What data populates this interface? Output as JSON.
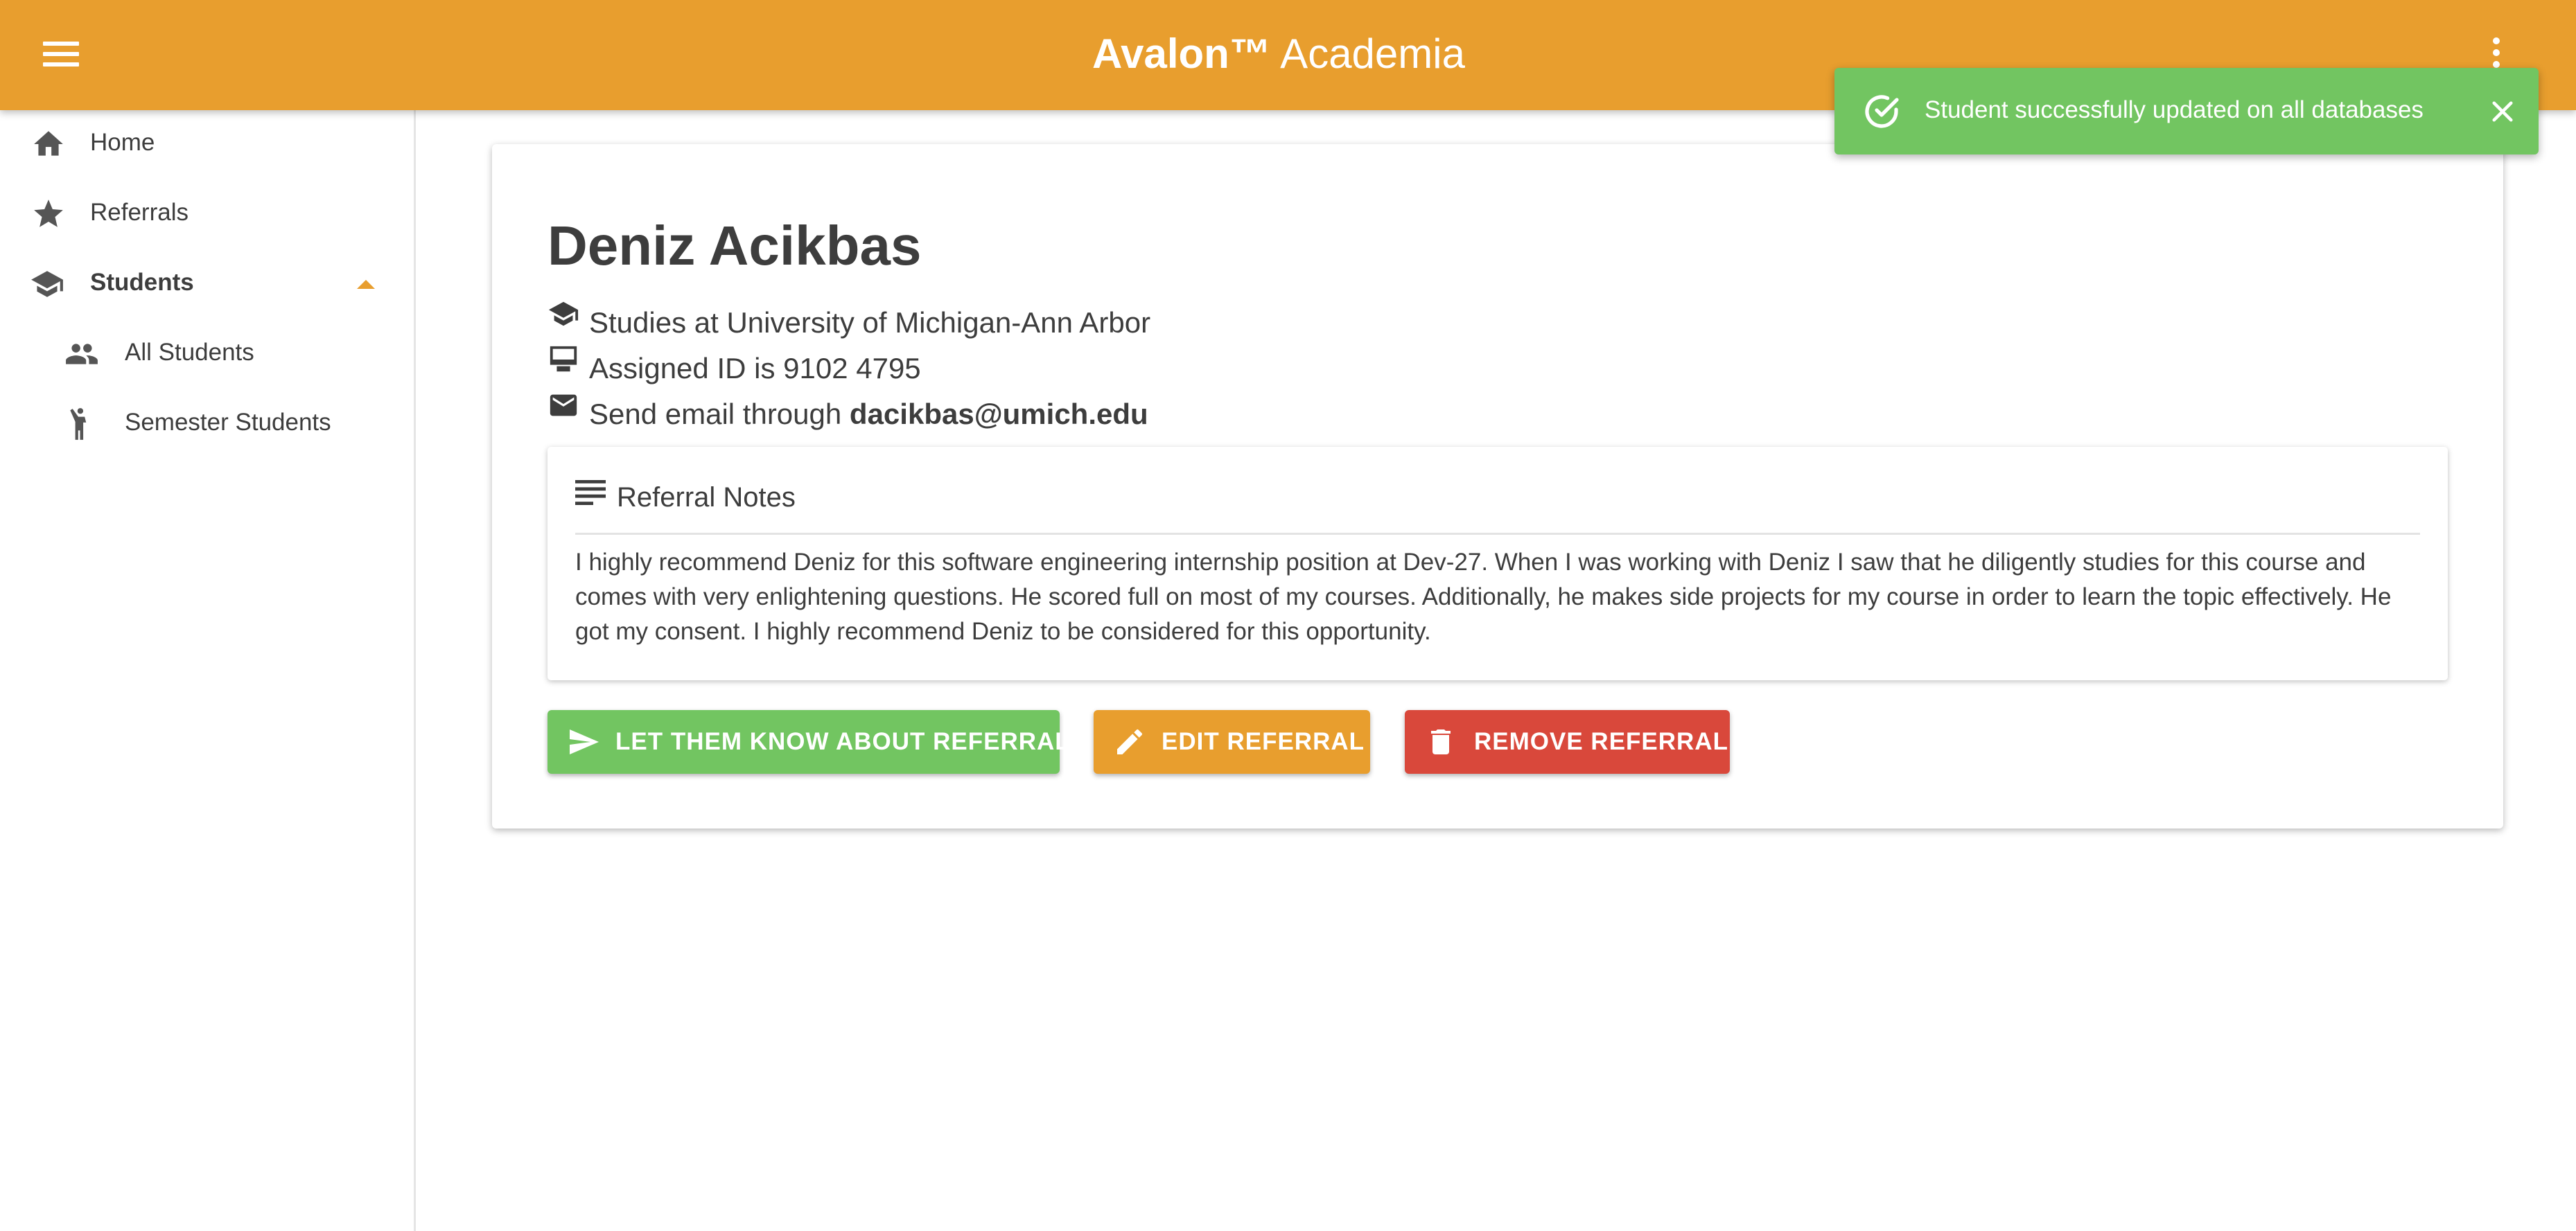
{
  "app": {
    "brand_bold": "Avalon",
    "brand_tm": "™",
    "brand_light": " Academia",
    "accent_color": "#e89e2e",
    "success_color": "#72c561",
    "danger_color": "#d9483b"
  },
  "sidebar": {
    "items": [
      {
        "label": "Home",
        "icon": "home-icon"
      },
      {
        "label": "Referrals",
        "icon": "star-icon"
      },
      {
        "label": "Students",
        "icon": "graduation-cap-icon",
        "expanded": true
      },
      {
        "label": "All Students",
        "icon": "people-icon"
      },
      {
        "label": "Semester Students",
        "icon": "person-raising-hand-icon"
      }
    ]
  },
  "student": {
    "name": "Deniz Acikbas",
    "studies_prefix": "Studies at ",
    "university": "University of Michigan-Ann Arbor",
    "id_prefix": "Assigned ID is ",
    "id": "9102 4795",
    "email_prefix": "Send email through ",
    "email": "dacikbas@umich.edu"
  },
  "notes": {
    "title": "Referral Notes",
    "body": "I highly recommend Deniz for this software engineering internship position at Dev-27. When I was working with Deniz I saw that he diligently studies for this course and comes with very enlightening questions. He scored full on most of my courses. Additionally, he makes side projects for my course in order to learn the topic effectively. He got my consent. I highly recommend Deniz to be considered for this opportunity."
  },
  "actions": {
    "send_label": "LET THEM KNOW ABOUT REFERRAL",
    "edit_label": "EDIT REFERRAL",
    "remove_label": "REMOVE REFERRAL"
  },
  "toast": {
    "message": "Student successfully updated on all databases"
  }
}
